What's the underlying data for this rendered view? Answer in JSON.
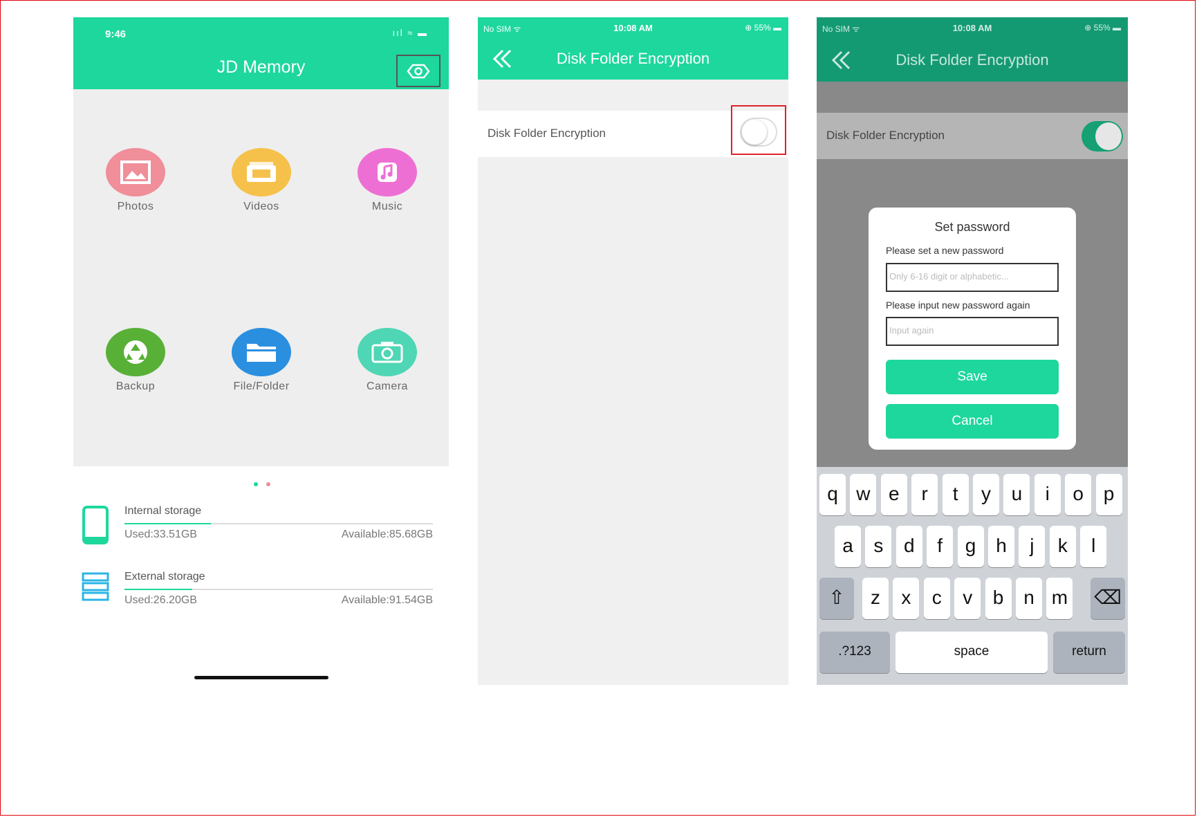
{
  "screen1": {
    "status_time": "9:46",
    "status_icons": "ııl ≈ ▬",
    "app_title": "JD Memory",
    "tiles": [
      {
        "label": "Photos",
        "icon": "photo-icon",
        "color": "#f08e9a"
      },
      {
        "label": "Videos",
        "icon": "video-icon",
        "color": "#f6c14b"
      },
      {
        "label": "Music",
        "icon": "music-icon",
        "color": "#ee6fd3"
      },
      {
        "label": "Backup",
        "icon": "recycle-icon",
        "color": "#58b036"
      },
      {
        "label": "File/Folder",
        "icon": "folder-icon",
        "color": "#2b8fe0"
      },
      {
        "label": "Camera",
        "icon": "camera-icon",
        "color": "#4fd6b4"
      }
    ],
    "storage": [
      {
        "name": "Internal storage",
        "used": "Used:33.51GB",
        "available": "Available:85.68GB",
        "used_fraction": 0.28
      },
      {
        "name": "External storage",
        "used": "Used:26.20GB",
        "available": "Available:91.54GB",
        "used_fraction": 0.22
      }
    ]
  },
  "screen2": {
    "status_carrier": "No SIM ᯤ",
    "status_time": "10:08 AM",
    "status_battery": "⊕ 55% ▬",
    "nav_title": "Disk Folder Encryption",
    "row_label": "Disk Folder Encryption",
    "toggle_on": false
  },
  "screen3": {
    "status_carrier": "No SIM ᯤ",
    "status_time": "10:08 AM",
    "status_battery": "⊕ 55% ▬",
    "nav_title": "Disk Folder Encryption",
    "row_label": "Disk Folder Encryption",
    "toggle_on": true,
    "dialog": {
      "title": "Set password",
      "label_new": "Please set a new password",
      "placeholder_new": "Only 6-16 digit or alphabetic...",
      "label_again": "Please input new password again",
      "placeholder_again": "Input again",
      "save": "Save",
      "cancel": "Cancel"
    },
    "keyboard": {
      "row1": [
        "q",
        "w",
        "e",
        "r",
        "t",
        "y",
        "u",
        "i",
        "o",
        "p"
      ],
      "row2": [
        "a",
        "s",
        "d",
        "f",
        "g",
        "h",
        "j",
        "k",
        "l"
      ],
      "row3": [
        "z",
        "x",
        "c",
        "v",
        "b",
        "n",
        "m"
      ],
      "shift": "⇧",
      "delete": "⌫",
      "numbers": ".?123",
      "space": "space",
      "return": "return"
    }
  },
  "colors": {
    "accent": "#1ed79d",
    "highlight": "#e0202a"
  }
}
